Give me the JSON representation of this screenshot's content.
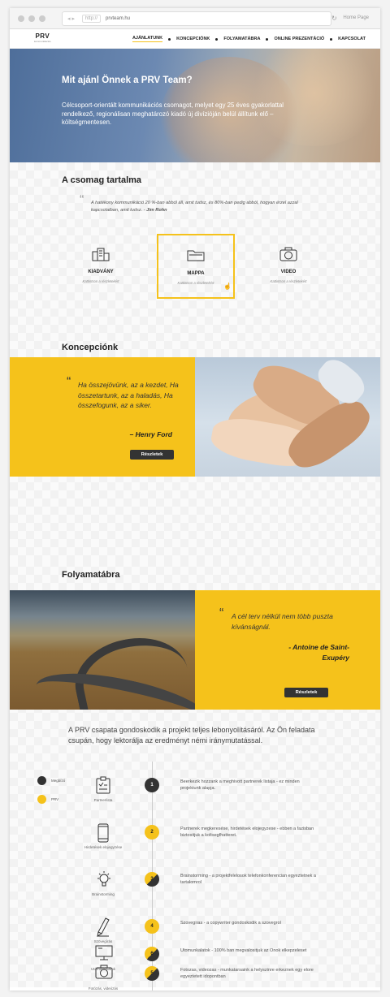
{
  "browser": {
    "url_proto": "http://",
    "url": "prvteam.hu",
    "homepage_label": "Home Page"
  },
  "nav": {
    "logo_main": "PRV",
    "logo_sub": "kommunikációs",
    "items": [
      {
        "label": "AJÁNLATUNK",
        "active": true
      },
      {
        "label": "KONCEPCIÓNK",
        "active": false
      },
      {
        "label": "FOLYAMATÁBRA",
        "active": false
      },
      {
        "label": "ONLINE PREZENTÁCIÓ",
        "active": false
      },
      {
        "label": "KAPCSOLAT",
        "active": false
      }
    ]
  },
  "hero": {
    "title": "Mit ajánl Önnek a PRV Team?",
    "text": "Célcsoport-orientált kommunikációs csomagot, melyet egy 25 éves gyakorlattal rendelkező, regionálisan meghatározó kiadó új divízióján belül állítunk elő – költségmentesen."
  },
  "csomag": {
    "title": "A csomag tartalma",
    "quote": "A hatékony kommunikáció 20 %-ban abból áll, amit tudsz, és 80%-ban pedig abból, hogyan érzel azzal kapcsolatban, amit tudsz. -",
    "quote_author": "Jim Rohn",
    "packages": [
      {
        "icon": "building-icon",
        "name": "KIADVÁNY",
        "sub": "Kattintson a részletekért",
        "selected": false
      },
      {
        "icon": "folder-icon",
        "name": "MAPPA",
        "sub": "Kattintson a részletekért",
        "selected": true
      },
      {
        "icon": "camera-icon",
        "name": "VIDEO",
        "sub": "Kattintson a részletekért",
        "selected": false
      }
    ]
  },
  "koncepcio": {
    "title": "Koncepciónk",
    "quote": "Ha összejövünk, az a kezdet, Ha összetartunk, az a haladás, Ha összefogunk, az a siker.",
    "author": "– Henry Ford",
    "button": "Részletek"
  },
  "folyamat": {
    "title": "Folyamatábra",
    "quote": "A cél terv nélkül nem több puszta kívánságnál.",
    "author": "- Antoine de Saint-Exupéry",
    "button": "Részletek",
    "intro": "A PRV csapata gondoskodik a projekt teljes lebonyolításáról. Az Ön feladata csupán, hogy lektorálja az eredményt némi iránymutatással.",
    "legend": [
      {
        "label": "Megbízó",
        "color": "#333333"
      },
      {
        "label": "PRV",
        "color": "#f5c21b"
      }
    ],
    "steps": [
      {
        "num": "1",
        "icon": "clipboard-icon",
        "label": "Partnerlista",
        "desc": "Beerkezik hozzank a meghivott partnerek listaja - ez minden projektunk alapja.",
        "owner": "client"
      },
      {
        "num": "2",
        "icon": "phone-icon",
        "label": "Hirdetések elojegyzése",
        "desc": "Partnerek megkeresése, hirdetések elojegyzese - ebben a fazisban biztositjuk a koltsegfhatteret.",
        "owner": "prv"
      },
      {
        "num": "3",
        "icon": "lightbulb-icon",
        "label": "Brainstorming",
        "desc": "Brainstorming - a projektfelelosok telefonkonferencian egyeztetnek a tartalomrol",
        "owner": "both"
      },
      {
        "num": "4",
        "icon": "pencil-icon",
        "label": "Szövegírás",
        "desc": "Szovegiras - a copywriter gondoskodik a szovegrol",
        "owner": "prv"
      },
      {
        "num": "5",
        "icon": "camera-icon",
        "label": "Fotózás, videózás",
        "desc": "Fotozas, videozas - munkatarsaink a helyszinre erkeznek egy elore egyeztetett idopontban",
        "owner": "both"
      },
      {
        "num": "6",
        "icon": "monitor-icon",
        "label": "Utómunkálatok",
        "desc": "Utomunkalatok - 100% ban megvalositjuk az Onok elkepzeleset",
        "owner": "both"
      }
    ]
  }
}
